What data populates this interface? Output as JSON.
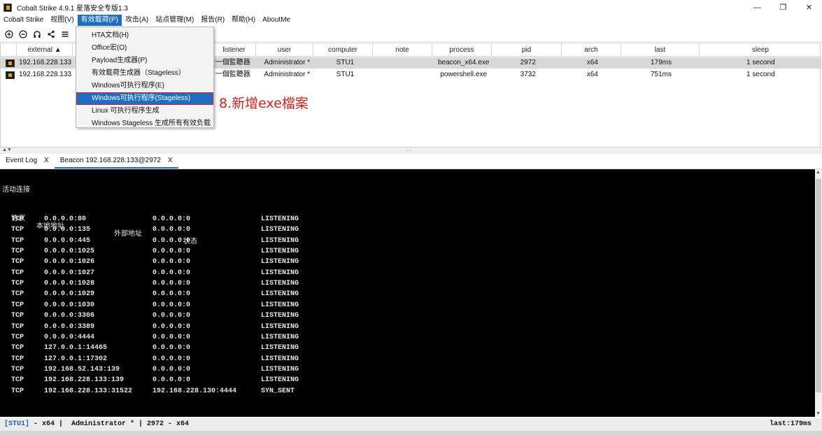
{
  "window": {
    "title": "Cobalt Strike 4.9.1 星落安全专版1.3",
    "controls": [
      "—",
      "❐",
      "✕"
    ]
  },
  "menubar": [
    "Cobalt Strike",
    "视图(V)",
    "有效载荷(P)",
    "攻击(A)",
    "站点管理(M)",
    "报告(R)",
    "帮助(H)",
    "AboutMe"
  ],
  "toolbar": [
    "plus-circle-icon",
    "minus-circle-icon",
    "headphones-icon",
    "share-icon",
    "list-icon"
  ],
  "dropdown": {
    "items": [
      "HTA文档(H)",
      "Office宏(O)",
      "Payload生成器(P)",
      "有效载荷生成器（Stageless）",
      "Windows可执行程序(E)",
      "Windows可执行程序(Stageless)",
      "Linux 可执行程序生成",
      "Windows Stageless 生成所有有效负载"
    ],
    "highlighted_index": 5
  },
  "annotation": "8.新增exe檔案",
  "table": {
    "columns": [
      "external ▲",
      "internal",
      "listener",
      "user",
      "computer",
      "note",
      "process",
      "pid",
      "arch",
      "last",
      "sleep"
    ],
    "rows": [
      {
        "external": "192.168.228.133",
        "listener": "一個監聽器",
        "user": "Administrator *",
        "computer": "STU1",
        "note": "",
        "process": "beacon_x64.exe",
        "pid": "2972",
        "arch": "x64",
        "last": "179ms",
        "sleep": "1 second"
      },
      {
        "external": "192.168.228.133",
        "listener": "一個監聽器",
        "user": "Administrator *",
        "computer": "STU1",
        "note": "",
        "process": "powershell.exe",
        "pid": "3732",
        "arch": "x64",
        "last": "751ms",
        "sleep": "1 second"
      }
    ]
  },
  "tabs": [
    {
      "label": "Event Log",
      "close": "X"
    },
    {
      "label": "Beacon 192.168.228.133@2972",
      "close": "X"
    }
  ],
  "console": {
    "heading": "活动连接",
    "headers": {
      "proto": "协议",
      "local": "本地地址",
      "foreign": "外部地址",
      "state": "状态"
    },
    "rows": [
      [
        "TCP",
        "0.0.0.0:80",
        "0.0.0.0:0",
        "LISTENING"
      ],
      [
        "TCP",
        "0.0.0.0:135",
        "0.0.0.0:0",
        "LISTENING"
      ],
      [
        "TCP",
        "0.0.0.0:445",
        "0.0.0.0:0",
        "LISTENING"
      ],
      [
        "TCP",
        "0.0.0.0:1025",
        "0.0.0.0:0",
        "LISTENING"
      ],
      [
        "TCP",
        "0.0.0.0:1026",
        "0.0.0.0:0",
        "LISTENING"
      ],
      [
        "TCP",
        "0.0.0.0:1027",
        "0.0.0.0:0",
        "LISTENING"
      ],
      [
        "TCP",
        "0.0.0.0:1028",
        "0.0.0.0:0",
        "LISTENING"
      ],
      [
        "TCP",
        "0.0.0.0:1029",
        "0.0.0.0:0",
        "LISTENING"
      ],
      [
        "TCP",
        "0.0.0.0:1030",
        "0.0.0.0:0",
        "LISTENING"
      ],
      [
        "TCP",
        "0.0.0.0:3306",
        "0.0.0.0:0",
        "LISTENING"
      ],
      [
        "TCP",
        "0.0.0.0:3389",
        "0.0.0.0:0",
        "LISTENING"
      ],
      [
        "TCP",
        "0.0.0.0:4444",
        "0.0.0.0:0",
        "LISTENING"
      ],
      [
        "TCP",
        "127.0.0.1:14465",
        "0.0.0.0:0",
        "LISTENING"
      ],
      [
        "TCP",
        "127.0.0.1:17302",
        "0.0.0.0:0",
        "LISTENING"
      ],
      [
        "TCP",
        "192.168.52.143:139",
        "0.0.0.0:0",
        "LISTENING"
      ],
      [
        "TCP",
        "192.168.228.133:139",
        "0.0.0.0:0",
        "LISTENING"
      ],
      [
        "TCP",
        "192.168.228.133:31522",
        "192.168.228.130:4444",
        "SYN_SENT"
      ]
    ]
  },
  "statusbar": {
    "computer": "[STU1]",
    "rest": " - x64 |  Administrator * | 2972 - x64",
    "last": "last:179ms"
  },
  "colors": {
    "accent": "#1e6fc4",
    "annotation": "#d42020",
    "console_bg": "#000000"
  }
}
